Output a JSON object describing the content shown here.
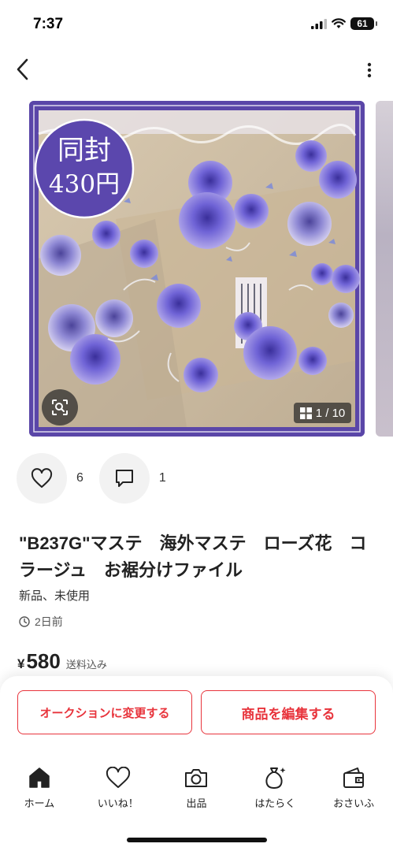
{
  "status_bar": {
    "time": "7:37",
    "battery": "61"
  },
  "photo": {
    "badge_line1": "同封",
    "badge_line2": "430円",
    "counter": "1 / 10"
  },
  "actions": {
    "like_count": "6",
    "comment_count": "1"
  },
  "item": {
    "title": "\"B237G\"マステ　海外マステ　ローズ花　コラージュ　お裾分けファイル",
    "condition": "新品、未使用",
    "posted": "2日前",
    "currency": "¥",
    "price": "580",
    "shipping": "送料込み"
  },
  "buttons": {
    "auction": "オークションに変更する",
    "edit": "商品を編集する"
  },
  "tabs": [
    {
      "label": "ホーム",
      "icon": "home-icon"
    },
    {
      "label": "いいね！",
      "icon": "heart-icon"
    },
    {
      "label": "出品",
      "icon": "camera-icon"
    },
    {
      "label": "はたらく",
      "icon": "money-bag-icon"
    },
    {
      "label": "おさいふ",
      "icon": "wallet-icon"
    }
  ],
  "colors": {
    "accent": "#e8343c",
    "photo_frame": "#5a46a8"
  }
}
